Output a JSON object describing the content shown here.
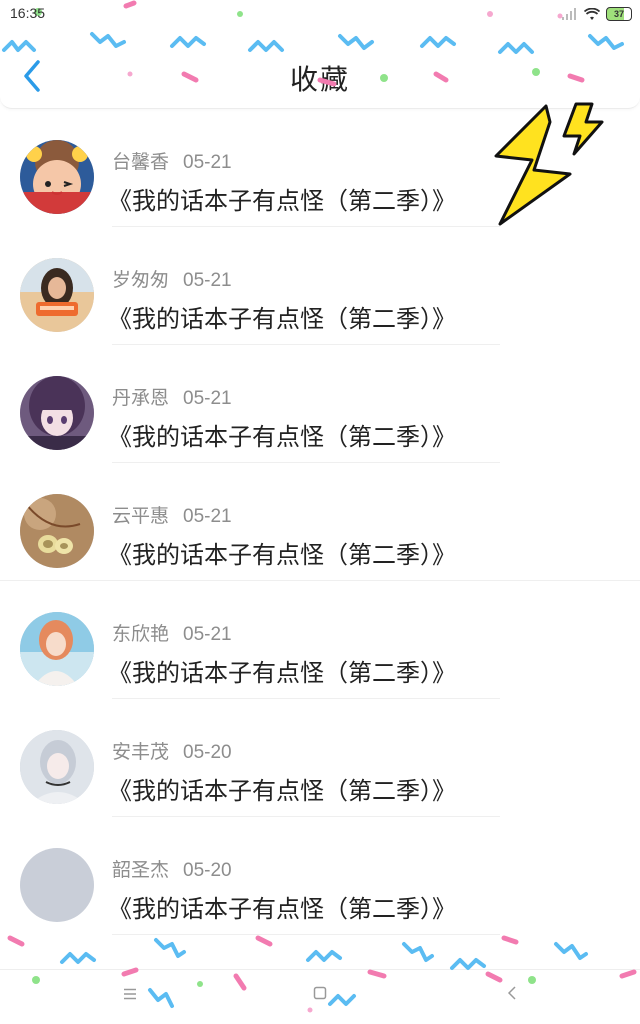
{
  "status": {
    "time": "16:35",
    "battery": "37"
  },
  "header": {
    "title": "收藏"
  },
  "favorites": [
    {
      "name": "台馨香",
      "date": "05-21",
      "title": "《我的话本子有点怪（第二季）》"
    },
    {
      "name": "岁匆匆",
      "date": "05-21",
      "title": "《我的话本子有点怪（第二季）》"
    },
    {
      "name": "丹承恩",
      "date": "05-21",
      "title": "《我的话本子有点怪（第二季）》"
    },
    {
      "name": "云平惠",
      "date": "05-21",
      "title": "《我的话本子有点怪（第二季）》"
    },
    {
      "name": "东欣艳",
      "date": "05-21",
      "title": "《我的话本子有点怪（第二季）》"
    },
    {
      "name": "安丰茂",
      "date": "05-20",
      "title": "《我的话本子有点怪（第二季）》"
    },
    {
      "name": "韶圣杰",
      "date": "05-20",
      "title": "《我的话本子有点怪（第二季）》"
    }
  ],
  "icons": {
    "back": "chevron-left-icon",
    "nav_menu": "menu-icon",
    "nav_home": "square-icon",
    "nav_back": "triangle-back-icon"
  },
  "colors": {
    "accent": "#2b9be8",
    "confetti_blue": "#5bbcf2",
    "confetti_pink": "#f27bb0",
    "confetti_green": "#8fe38a",
    "bolt": "#ffe21f"
  }
}
